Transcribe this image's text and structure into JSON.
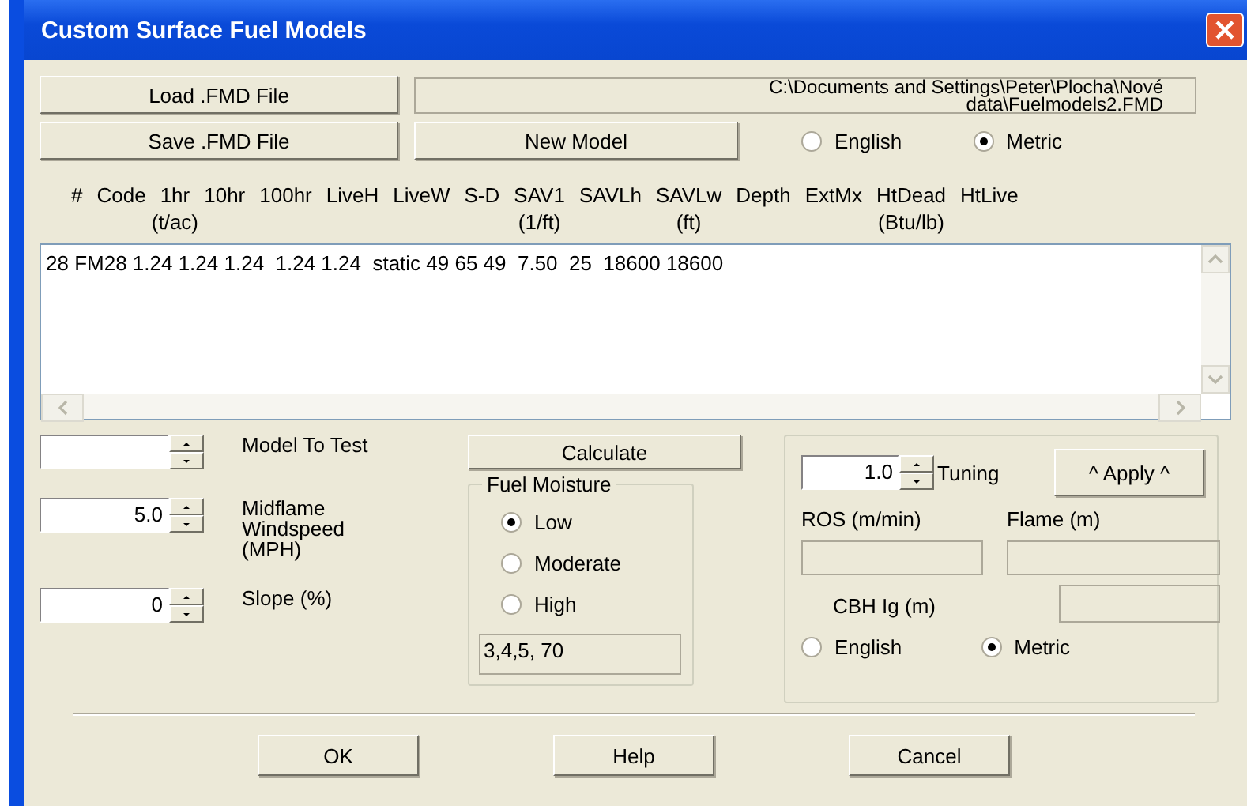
{
  "window": {
    "title": "Custom Surface Fuel Models"
  },
  "load_button": "Load .FMD File",
  "file_path_lines": [
    "C:\\Documents and Settings\\Peter\\Plocha\\Nové",
    "data\\Fuelmodels2.FMD"
  ],
  "save_button": "Save .FMD File",
  "new_model_button": "New Model",
  "units": [
    {
      "label": "English",
      "selected": false
    },
    {
      "label": "Metric",
      "selected": true
    }
  ],
  "columns": [
    {
      "label": "#"
    },
    {
      "label": "Code"
    },
    {
      "label": "1hr",
      "unit": "(t/ac)"
    },
    {
      "label": "10hr"
    },
    {
      "label": "100hr"
    },
    {
      "label": "LiveH"
    },
    {
      "label": "LiveW"
    },
    {
      "label": "S-D"
    },
    {
      "label": "SAV1",
      "unit": "(1/ft)"
    },
    {
      "label": "SAVLh"
    },
    {
      "label": "SAVLw",
      "unit": "(ft)"
    },
    {
      "label": "Depth"
    },
    {
      "label": "ExtMx"
    },
    {
      "label": "HtDead",
      "unit": "(Btu/lb)"
    },
    {
      "label": "HtLive"
    }
  ],
  "model_lines": [
    "28 FM28 1.24 1.24 1.24  1.24 1.24  static 49 65 49  7.50  25  18600 18600"
  ],
  "spinners": [
    {
      "label": "Model To Test"
    },
    {
      "label": "Midflame Windspeed (MPH)",
      "value": "5.0"
    },
    {
      "label": "Slope (%)",
      "value": "0"
    }
  ],
  "calculate_button": "Calculate",
  "fuel_moisture": {
    "title": "Fuel Moisture",
    "options": [
      {
        "label": "Low",
        "selected": true
      },
      {
        "label": "Moderate",
        "selected": false
      },
      {
        "label": "High",
        "selected": false
      }
    ],
    "values_text": "3,4,5, 70"
  },
  "output": {
    "tuning_value": "1.0",
    "tuning_label": "Tuning",
    "apply_button": "^ Apply ^",
    "ros_label": "ROS (m/min)",
    "flame_label": "Flame (m)",
    "cbh_label": "CBH Ig (m)",
    "units": [
      {
        "label": "English",
        "selected": false
      },
      {
        "label": "Metric",
        "selected": true
      }
    ]
  },
  "buttons": [
    "OK",
    "Help",
    "Cancel"
  ]
}
